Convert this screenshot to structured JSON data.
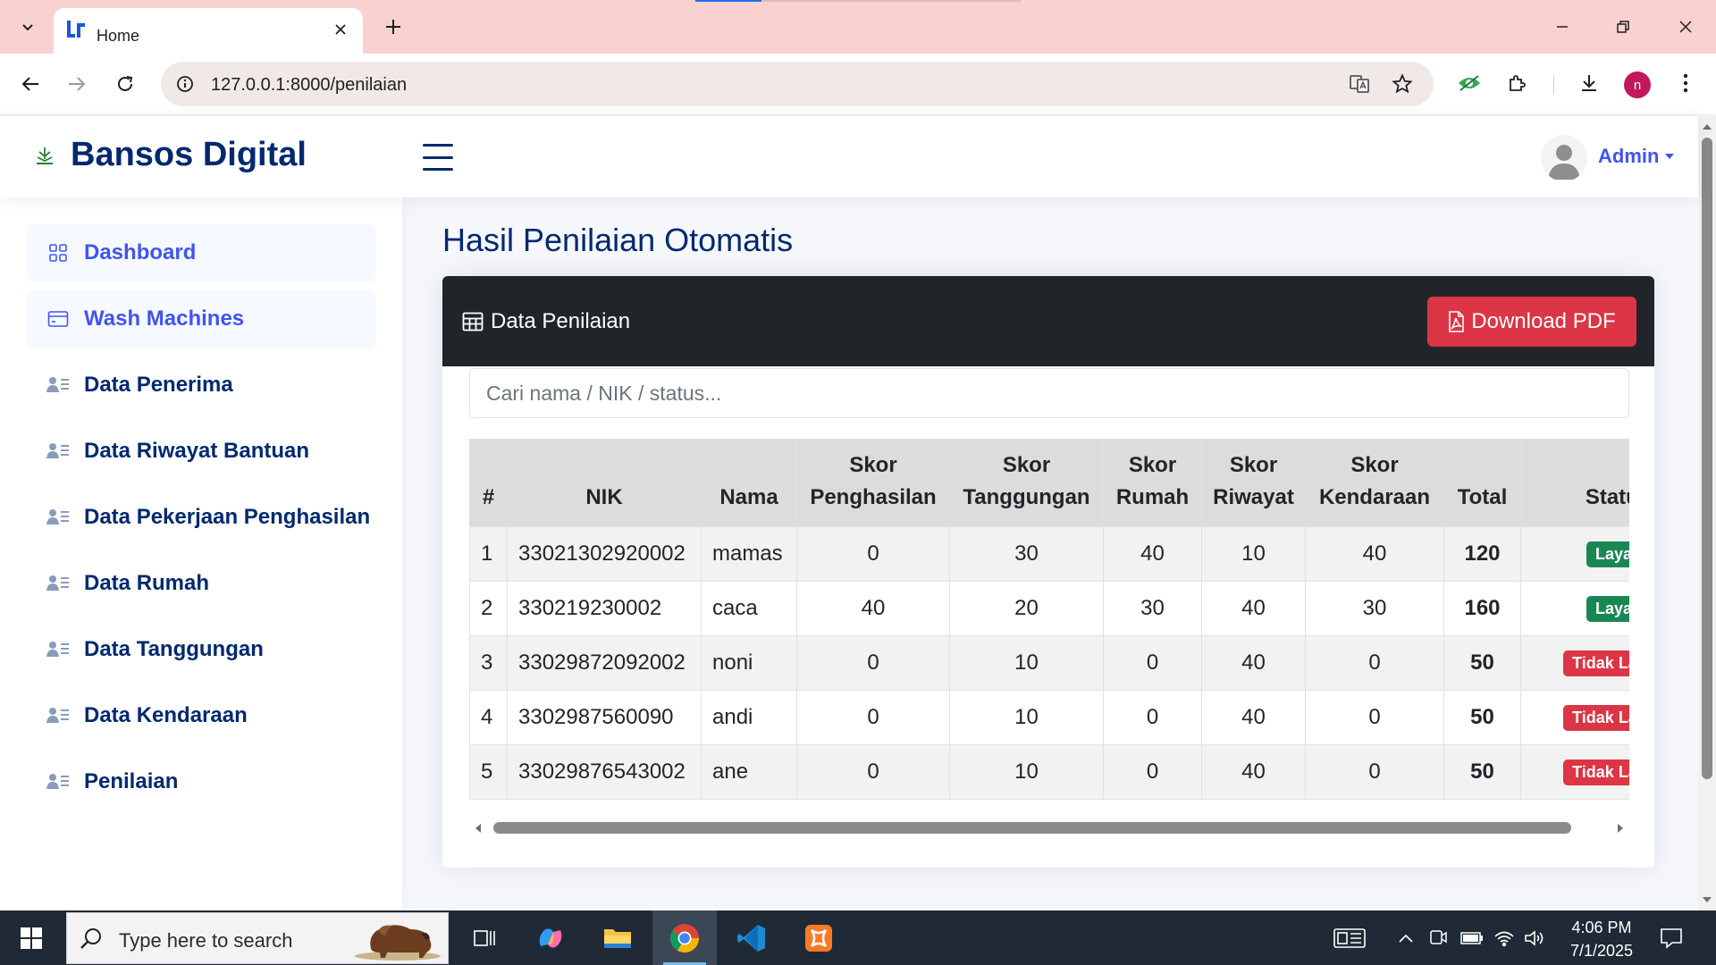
{
  "browser": {
    "tab_title": "Home",
    "url": "127.0.0.1:8000/penilaian",
    "profile_initial": "n"
  },
  "header": {
    "brand": "Bansos Digital",
    "user": "Admin"
  },
  "sidebar": {
    "items": [
      {
        "label": "Dashboard",
        "icon": "grid-icon"
      },
      {
        "label": "Wash Machines",
        "icon": "card-icon"
      },
      {
        "label": "Data Penerima",
        "icon": "person-lines-icon"
      },
      {
        "label": "Data Riwayat Bantuan",
        "icon": "person-lines-icon"
      },
      {
        "label": "Data Pekerjaan Penghasilan",
        "icon": "person-lines-icon"
      },
      {
        "label": "Data Rumah",
        "icon": "person-lines-icon"
      },
      {
        "label": "Data Tanggungan",
        "icon": "person-lines-icon"
      },
      {
        "label": "Data Kendaraan",
        "icon": "person-lines-icon"
      },
      {
        "label": "Penilaian",
        "icon": "person-lines-icon"
      }
    ]
  },
  "main": {
    "page_title": "Hasil Penilaian Otomatis",
    "card_title": "Data Penilaian",
    "download_label": "Download PDF",
    "search_placeholder": "Cari nama / NIK / status...",
    "table": {
      "headers": {
        "no": "#",
        "nik": "NIK",
        "nama": "Nama",
        "penghasilan": [
          "Skor",
          "Penghasilan"
        ],
        "tanggungan": [
          "Skor",
          "Tanggungan"
        ],
        "rumah": [
          "Skor",
          "Rumah"
        ],
        "riwayat": [
          "Skor",
          "Riwayat"
        ],
        "kendaraan": [
          "Skor",
          "Kendaraan"
        ],
        "total": "Total",
        "status": "Status"
      },
      "rows": [
        {
          "no": "1",
          "nik": "33021302920002",
          "nama": "mamas",
          "penghasilan": "0",
          "tanggungan": "30",
          "rumah": "40",
          "riwayat": "10",
          "kendaraan": "40",
          "total": "120",
          "status": "Layak"
        },
        {
          "no": "2",
          "nik": "330219230002",
          "nama": "caca",
          "penghasilan": "40",
          "tanggungan": "20",
          "rumah": "30",
          "riwayat": "40",
          "kendaraan": "30",
          "total": "160",
          "status": "Layak"
        },
        {
          "no": "3",
          "nik": "33029872092002",
          "nama": "noni",
          "penghasilan": "0",
          "tanggungan": "10",
          "rumah": "0",
          "riwayat": "40",
          "kendaraan": "0",
          "total": "50",
          "status": "Tidak Layak"
        },
        {
          "no": "4",
          "nik": "3302987560090",
          "nama": "andi",
          "penghasilan": "0",
          "tanggungan": "10",
          "rumah": "0",
          "riwayat": "40",
          "kendaraan": "0",
          "total": "50",
          "status": "Tidak Layak"
        },
        {
          "no": "5",
          "nik": "33029876543002",
          "nama": "ane",
          "penghasilan": "0",
          "tanggungan": "10",
          "rumah": "0",
          "riwayat": "40",
          "kendaraan": "0",
          "total": "50",
          "status": "Tidak Layak"
        }
      ]
    }
  },
  "taskbar": {
    "search_placeholder": "Type here to search",
    "time": "4:06 PM",
    "date": "7/1/2025"
  },
  "colors": {
    "brand": "#012970",
    "accent": "#4154f1",
    "danger": "#dc3545",
    "success": "#198754",
    "card_header": "#212529"
  }
}
